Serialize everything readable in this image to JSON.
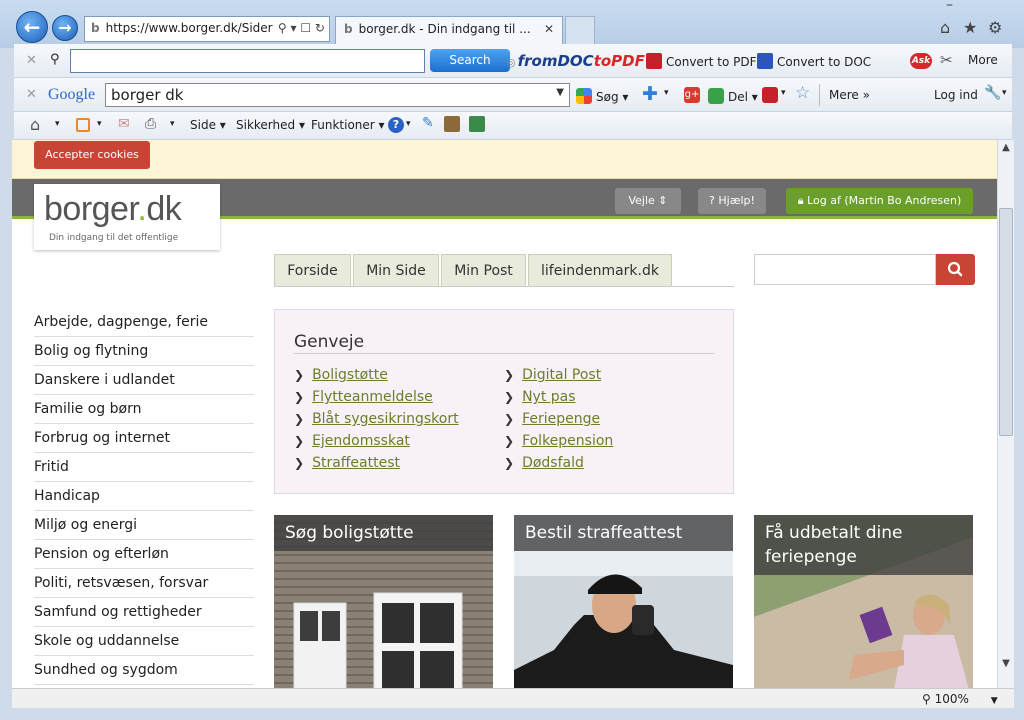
{
  "browser": {
    "address_url": "https://www.borger.dk/Sider",
    "tab_title": "borger.dk - Din indgang til ...",
    "zoom": "100%"
  },
  "toolbar1": {
    "search_label": "Search",
    "fromdoctopdf_a": "fromDOC",
    "fromdoctopdf_b": "toPDF",
    "convert_pdf": "Convert to PDF",
    "convert_doc": "Convert to DOC",
    "ask_label": "Ask",
    "more": "More"
  },
  "toolbar2": {
    "google_logo": "Google",
    "google_query": "borger dk",
    "sog": "Søg",
    "del": "Del",
    "mere": "Mere",
    "log_ind": "Log ind"
  },
  "toolbar3": {
    "side": "Side",
    "sikkerhed": "Sikkerhed",
    "funktioner": "Funktioner"
  },
  "page": {
    "cookie_button": "Accepter cookies",
    "logo_main": "borger",
    "logo_dot": ".",
    "logo_suffix": "dk",
    "logo_tagline": "Din indgang    til det offentlige",
    "location": "Vejle",
    "help": "Hjælp!",
    "logout": "Log af (Martin Bo Andresen)",
    "nav_tabs": [
      "Forside",
      "Min Side",
      "Min Post",
      "lifeindenmark.dk"
    ],
    "menu": [
      "Arbejde, dagpenge, ferie",
      "Bolig og flytning",
      "Danskere i udlandet",
      "Familie og børn",
      "Forbrug og internet",
      "Fritid",
      "Handicap",
      "Miljø og energi",
      "Pension og efterløn",
      "Politi, retsvæsen, forsvar",
      "Samfund og rettigheder",
      "Skole og uddannelse",
      "Sundhed og sygdom"
    ],
    "genveje_title": "Genveje",
    "genveje_left": [
      "Boligstøtte",
      "Flytteanmeldelse",
      "Blåt sygesikringskort",
      "Ejendomsskat",
      "Straffeattest"
    ],
    "genveje_right": [
      "Digital Post",
      "Nyt pas",
      "Feriepenge",
      "Folkepension",
      "Dødsfald"
    ],
    "tiles": [
      "Søg boligstøtte",
      "Bestil straffeattest",
      "Få udbetalt dine feriepenge"
    ]
  },
  "colors": {
    "accent_red": "#c94435",
    "brand_green": "#8ab73a",
    "link_green": "#6d7d2a"
  }
}
